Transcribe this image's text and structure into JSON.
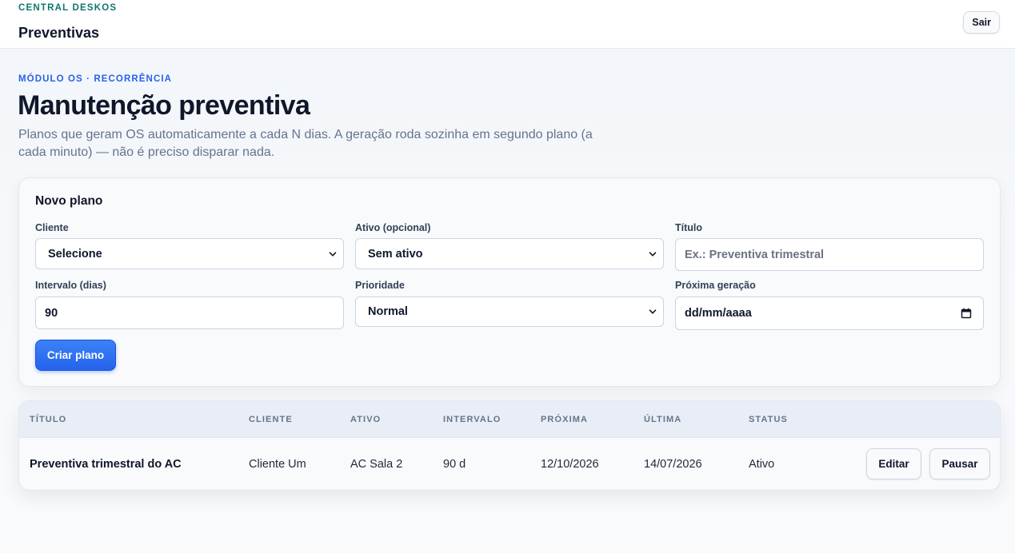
{
  "header": {
    "brand": "CENTRAL DESKOS",
    "title": "Preventivas",
    "logout_label": "Sair"
  },
  "page": {
    "eyebrow": "MÓDULO OS · RECORRÊNCIA",
    "title": "Manutenção preventiva",
    "description": "Planos que geram OS automaticamente a cada N dias. A geração roda sozinha em segundo plano (a cada minuto) — não é preciso disparar nada."
  },
  "form": {
    "title": "Novo plano",
    "cliente": {
      "label": "Cliente",
      "value": "Selecione"
    },
    "ativo": {
      "label": "Ativo (opcional)",
      "value": "Sem ativo"
    },
    "titulo": {
      "label": "Título",
      "value": "",
      "placeholder": "Ex.: Preventiva trimestral"
    },
    "intervalo": {
      "label": "Intervalo (dias)",
      "value": "90"
    },
    "prioridade": {
      "label": "Prioridade",
      "value": "Normal"
    },
    "proxima": {
      "label": "Próxima geração",
      "value": "dd/mm/aaaa"
    },
    "submit_label": "Criar plano"
  },
  "table": {
    "columns": [
      "TÍTULO",
      "CLIENTE",
      "ATIVO",
      "INTERVALO",
      "PRÓXIMA",
      "ÚLTIMA",
      "STATUS"
    ],
    "rows": [
      {
        "titulo": "Preventiva trimestral do AC",
        "cliente": "Cliente Um",
        "ativo": "AC Sala 2",
        "intervalo": "90 d",
        "proxima": "12/10/2026",
        "ultima": "14/07/2026",
        "status": "Ativo",
        "edit_label": "Editar",
        "pause_label": "Pausar"
      }
    ]
  }
}
